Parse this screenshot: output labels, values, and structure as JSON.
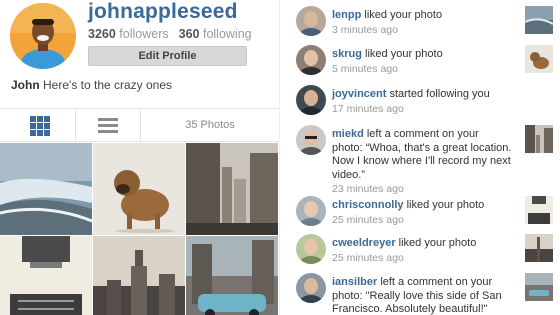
{
  "profile": {
    "username": "johnappleseed",
    "followers_count": "3260",
    "followers_label": "followers",
    "following_count": "360",
    "following_label": "following",
    "edit_button": "Edit Profile",
    "bio_name": "John",
    "bio_text": "Here's to the crazy ones",
    "photo_count": "35 Photos",
    "view_grid_icon": "grid-icon",
    "view_list_icon": "list-icon"
  },
  "feed": {
    "items": [
      {
        "user": "lenpp",
        "action": "liked your photo",
        "time": "3 minutes ago"
      },
      {
        "user": "skrug",
        "action": "liked your photo",
        "time": "5 minutes ago"
      },
      {
        "user": "joyvincent",
        "action": "started following you",
        "time": "17 minutes ago"
      },
      {
        "user": "miekd",
        "action": "left a comment on your photo: “Whoa, that's a great location. Now I know where I'll record my next video.”",
        "time": "23 minutes ago"
      },
      {
        "user": "chrisconnolly",
        "action": "liked your photo",
        "time": "25 minutes ago"
      },
      {
        "user": "cweeldreyer",
        "action": "liked your photo",
        "time": "25 minutes ago"
      },
      {
        "user": "iansilber",
        "action": "left a comment on your photo: \"Really love this side of San Francisco. Absolutely beautiful!\"",
        "time": ""
      }
    ]
  },
  "colors": {
    "accent": "#3b6998",
    "muted": "#999999",
    "button_bg": "#d8d8d8"
  }
}
